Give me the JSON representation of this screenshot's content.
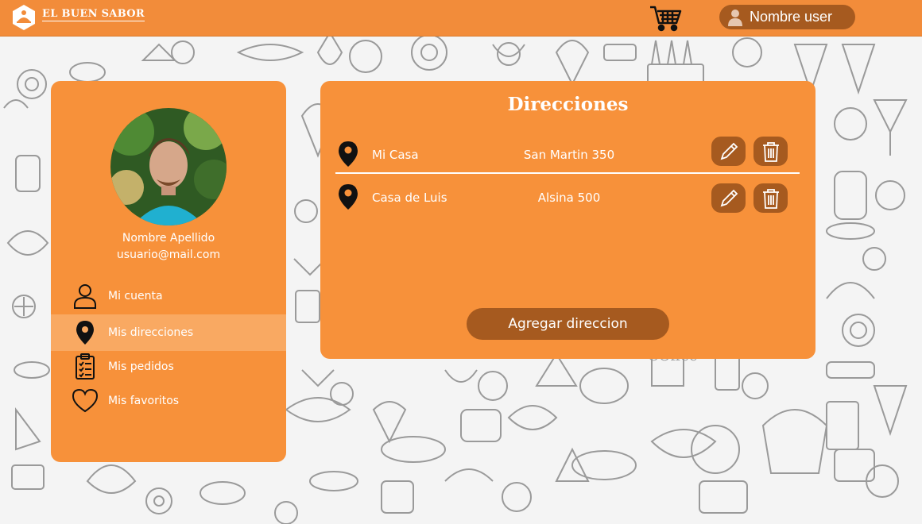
{
  "header": {
    "brand": "EL BUEN SABOR",
    "user_name": "Nombre user"
  },
  "profile": {
    "name": "Nombre Apellido",
    "email": "usuario@mail.com",
    "menu": [
      {
        "label": "Mi cuenta",
        "icon": "user-icon"
      },
      {
        "label": "Mis direcciones",
        "icon": "location-pin-icon",
        "active": true
      },
      {
        "label": "Mis pedidos",
        "icon": "clipboard-list-icon"
      },
      {
        "label": "Mis favoritos",
        "icon": "heart-icon"
      }
    ]
  },
  "addresses": {
    "title": "Direcciones",
    "items": [
      {
        "name": "Mi Casa",
        "street": "San Martin 350"
      },
      {
        "name": "Casa de Luis",
        "street": "Alsina 500"
      }
    ],
    "add_label": "Agregar direccion"
  },
  "colors": {
    "brand_orange": "#f28c3a",
    "panel_orange": "#f7913a",
    "active_item": "#f9a962",
    "dark_brown": "#a65a1f"
  }
}
